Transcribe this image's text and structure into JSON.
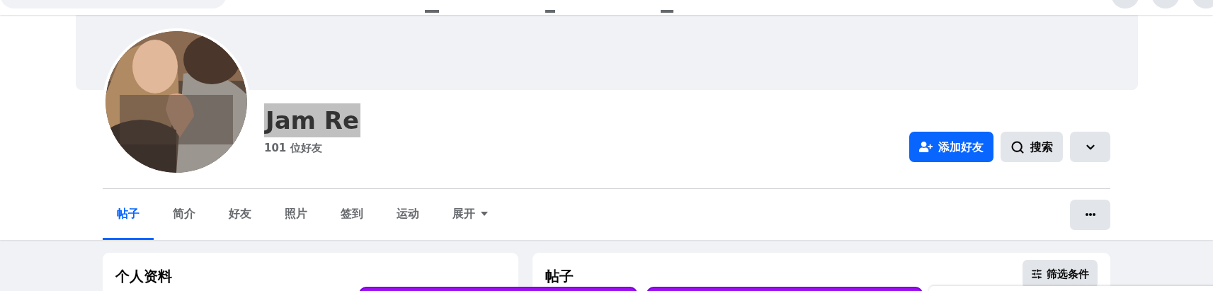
{
  "profile": {
    "name": "Jam Re",
    "name_highlighted": true,
    "friends": "101 位好友"
  },
  "actions": [
    {
      "kind": "primary",
      "label": "添加好友"
    },
    {
      "kind": "secondary",
      "label": "搜索"
    },
    {
      "kind": "menu"
    }
  ],
  "tabs": [
    {
      "label": "帖子",
      "selected": true
    },
    {
      "label": "简介",
      "selected": false
    },
    {
      "label": "好友",
      "selected": false
    },
    {
      "label": "照片",
      "selected": false
    },
    {
      "label": "签到",
      "selected": false
    },
    {
      "label": "运动",
      "selected": false
    },
    {
      "label": "展开",
      "selected": false,
      "kind": "dropdown"
    }
  ],
  "left_card": {
    "title": "个人资料"
  },
  "right_card": {
    "title": "帖子",
    "filter_button": "筛选条件"
  }
}
